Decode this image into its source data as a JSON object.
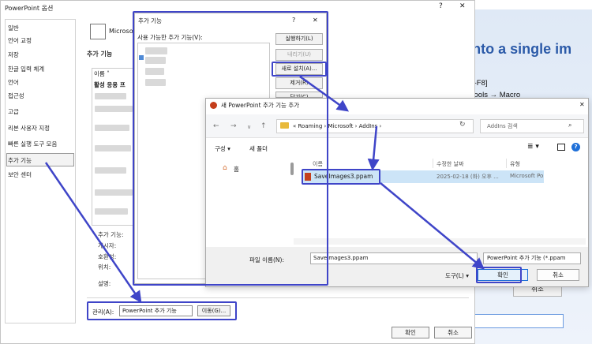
{
  "slide": {
    "title": "ave Selected Shapes into a single im",
    "line1": "Press [Alt-F8]",
    "line2": "Or goto Development Tools → Macro",
    "cancel_label": "취소"
  },
  "options_window": {
    "title": "PowerPoint 옵션",
    "help_glyph": "?",
    "close_glyph": "✕",
    "nav_items": [
      "일반",
      "언어 교정",
      "저장",
      "한글 입력 체계",
      "언어",
      "접근성",
      "고급",
      "리본 사용자 지정",
      "빠른 실행 도구 모음",
      "추가 기능",
      "보안 센터"
    ],
    "selected_nav": "추가 기능",
    "ms_text": "Microso",
    "section_heading": "추가 기능",
    "grid_col_name": "이름 ˄",
    "grid_group_active": "활성 응용 프",
    "detail_labels": [
      "추가 기능:",
      "게시자:",
      "호환성:",
      "위치:",
      "설명:"
    ],
    "manage_label": "관리(A):",
    "manage_value": "PowerPoint 추가 기능",
    "go_label": "이동(G)...",
    "ok_label": "확인",
    "cancel_label": "취소"
  },
  "addins_dialog": {
    "title": "추가 기능",
    "help_glyph": "?",
    "close_glyph": "✕",
    "available_label": "사용 가능한 추가 기능(V):",
    "buttons": [
      {
        "label": "실행하기(L)",
        "enabled": true
      },
      {
        "label": "내리기(U)",
        "enabled": false
      },
      {
        "label": "새로 설치(A)...",
        "enabled": true
      },
      {
        "label": "제거(R)",
        "enabled": true
      },
      {
        "label": "닫기(C)",
        "enabled": true
      }
    ]
  },
  "file_dialog": {
    "title": "새 PowerPoint 추가 기능 추가",
    "close_glyph": "✕",
    "path": "«  Roaming  ›  Microsoft  ›  AddIns  ›",
    "search_placeholder": "AddIns 검색",
    "organize": "구성 ▾",
    "new_folder": "새 폴더",
    "home_label": "홈",
    "columns": [
      "이름",
      "수정한 날짜",
      "유형"
    ],
    "files": [
      {
        "name": "SaveImages3.ppam",
        "modified": "2025-02-18 (화) 오후 ...",
        "type": "Microsoft Po"
      }
    ],
    "filename_label": "파일 이름(N):",
    "filename_value": "SaveImages3.ppam",
    "filetype_value": "PowerPoint 추가 기능 (*.ppam",
    "tools_label": "도구(L)   ▾",
    "open_label": "확인",
    "cancel_label": "취소"
  },
  "colors": {
    "annotation": "#3f45c8",
    "slide_title": "#2b5aa8",
    "file_selected": "#cce4f7",
    "primary_button_border": "#1e6fd8"
  }
}
